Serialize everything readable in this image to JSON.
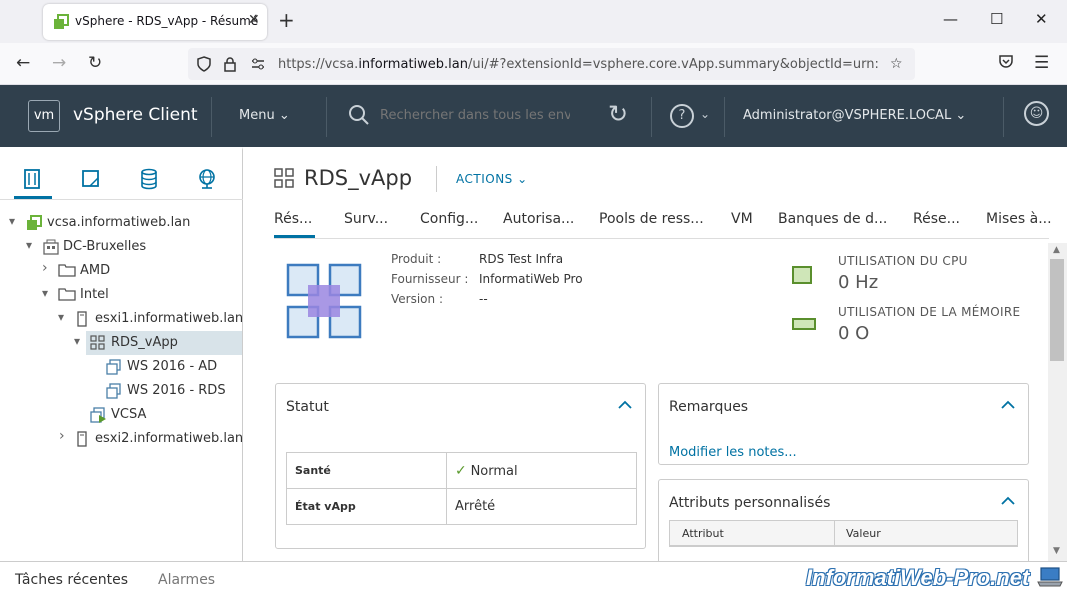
{
  "browser": {
    "tab_title": "vSphere - RDS_vApp - Résumé",
    "tab_close": "✕",
    "new_tab": "+",
    "url_prefix": "https://vcsa.",
    "url_domain": "informatiweb.lan",
    "url_rest": "/ui/#?extensionId=vsphere.core.vApp.summary&objectId=urn:vmomi:V",
    "window_controls": [
      "—",
      "☐",
      "✕"
    ],
    "icons": {
      "back": "back-arrow-icon",
      "forward": "forward-arrow-icon",
      "reload": "reload-icon",
      "shield": "shield-icon",
      "lock": "lock-icon",
      "permissions": "permissions-icon",
      "star": "star-icon",
      "pocket": "pocket-icon",
      "menu": "hamburger-menu-icon"
    }
  },
  "header": {
    "logo": "vm",
    "title": "vSphere Client",
    "menu_label": "Menu",
    "search_placeholder": "Rechercher dans tous les envi",
    "user": "Administrator@VSPHERE.LOCAL",
    "help": "?",
    "smile": "☺"
  },
  "navigator": {
    "tab_icons": [
      "hosts-clusters-icon",
      "vms-templates-icon",
      "storage-icon",
      "networking-icon"
    ],
    "tree": [
      {
        "label": "vcsa.informatiweb.lan",
        "icon": "vcenter-icon",
        "arrow": "▾",
        "level": 0
      },
      {
        "label": "DC-Bruxelles",
        "icon": "datacenter-icon",
        "arrow": "▾",
        "level": 1
      },
      {
        "label": "AMD",
        "icon": "folder-icon",
        "arrow": "›",
        "level": 2
      },
      {
        "label": "Intel",
        "icon": "folder-icon",
        "arrow": "▾",
        "level": 2
      },
      {
        "label": "esxi1.informatiweb.lan",
        "icon": "host-icon",
        "arrow": "▾",
        "level": 3
      },
      {
        "label": "RDS_vApp",
        "icon": "vapp-icon",
        "arrow": "▾",
        "level": 4,
        "selected": true
      },
      {
        "label": "WS 2016 - AD",
        "icon": "vm-icon",
        "arrow": "",
        "level": 5
      },
      {
        "label": "WS 2016 - RDS",
        "icon": "vm-icon",
        "arrow": "",
        "level": 5
      },
      {
        "label": "VCSA",
        "icon": "vm-running-icon",
        "arrow": "",
        "level": 4
      },
      {
        "label": "esxi2.informatiweb.lan",
        "icon": "host-icon",
        "arrow": "›",
        "level": 3
      }
    ]
  },
  "content": {
    "title": "RDS_vApp",
    "actions_label": "ACTIONS",
    "tabs": [
      "Rés...",
      "Surv...",
      "Config...",
      "Autorisa...",
      "Pools de ress...",
      "VM",
      "Banques de d...",
      "Rése...",
      "Mises à..."
    ],
    "info": {
      "product_label": "Produit :",
      "product_value": "RDS Test Infra",
      "vendor_label": "Fournisseur :",
      "vendor_value": "InformatiWeb Pro",
      "version_label": "Version :",
      "version_value": "--"
    },
    "resources": {
      "cpu_label": "UTILISATION DU CPU",
      "cpu_value": "0 Hz",
      "mem_label": "UTILISATION DE LA MÉMOIRE",
      "mem_value": "0 O"
    },
    "status_card": {
      "title": "Statut",
      "health_label": "Santé",
      "health_value": "Normal",
      "state_label": "État vApp",
      "state_value": "Arrêté"
    },
    "notes_card": {
      "title": "Remarques",
      "link": "Modifier les notes..."
    },
    "attrs_card": {
      "title": "Attributs personnalisés",
      "col_attr": "Attribut",
      "col_value": "Valeur"
    }
  },
  "bottom": {
    "recent_tasks": "Tâches récentes",
    "alarms": "Alarmes"
  },
  "watermark": "InformatiWeb-Pro.net",
  "colors": {
    "header_bg": "#30404d",
    "accent": "#0072a3",
    "ok_green": "#5a9a2d"
  }
}
